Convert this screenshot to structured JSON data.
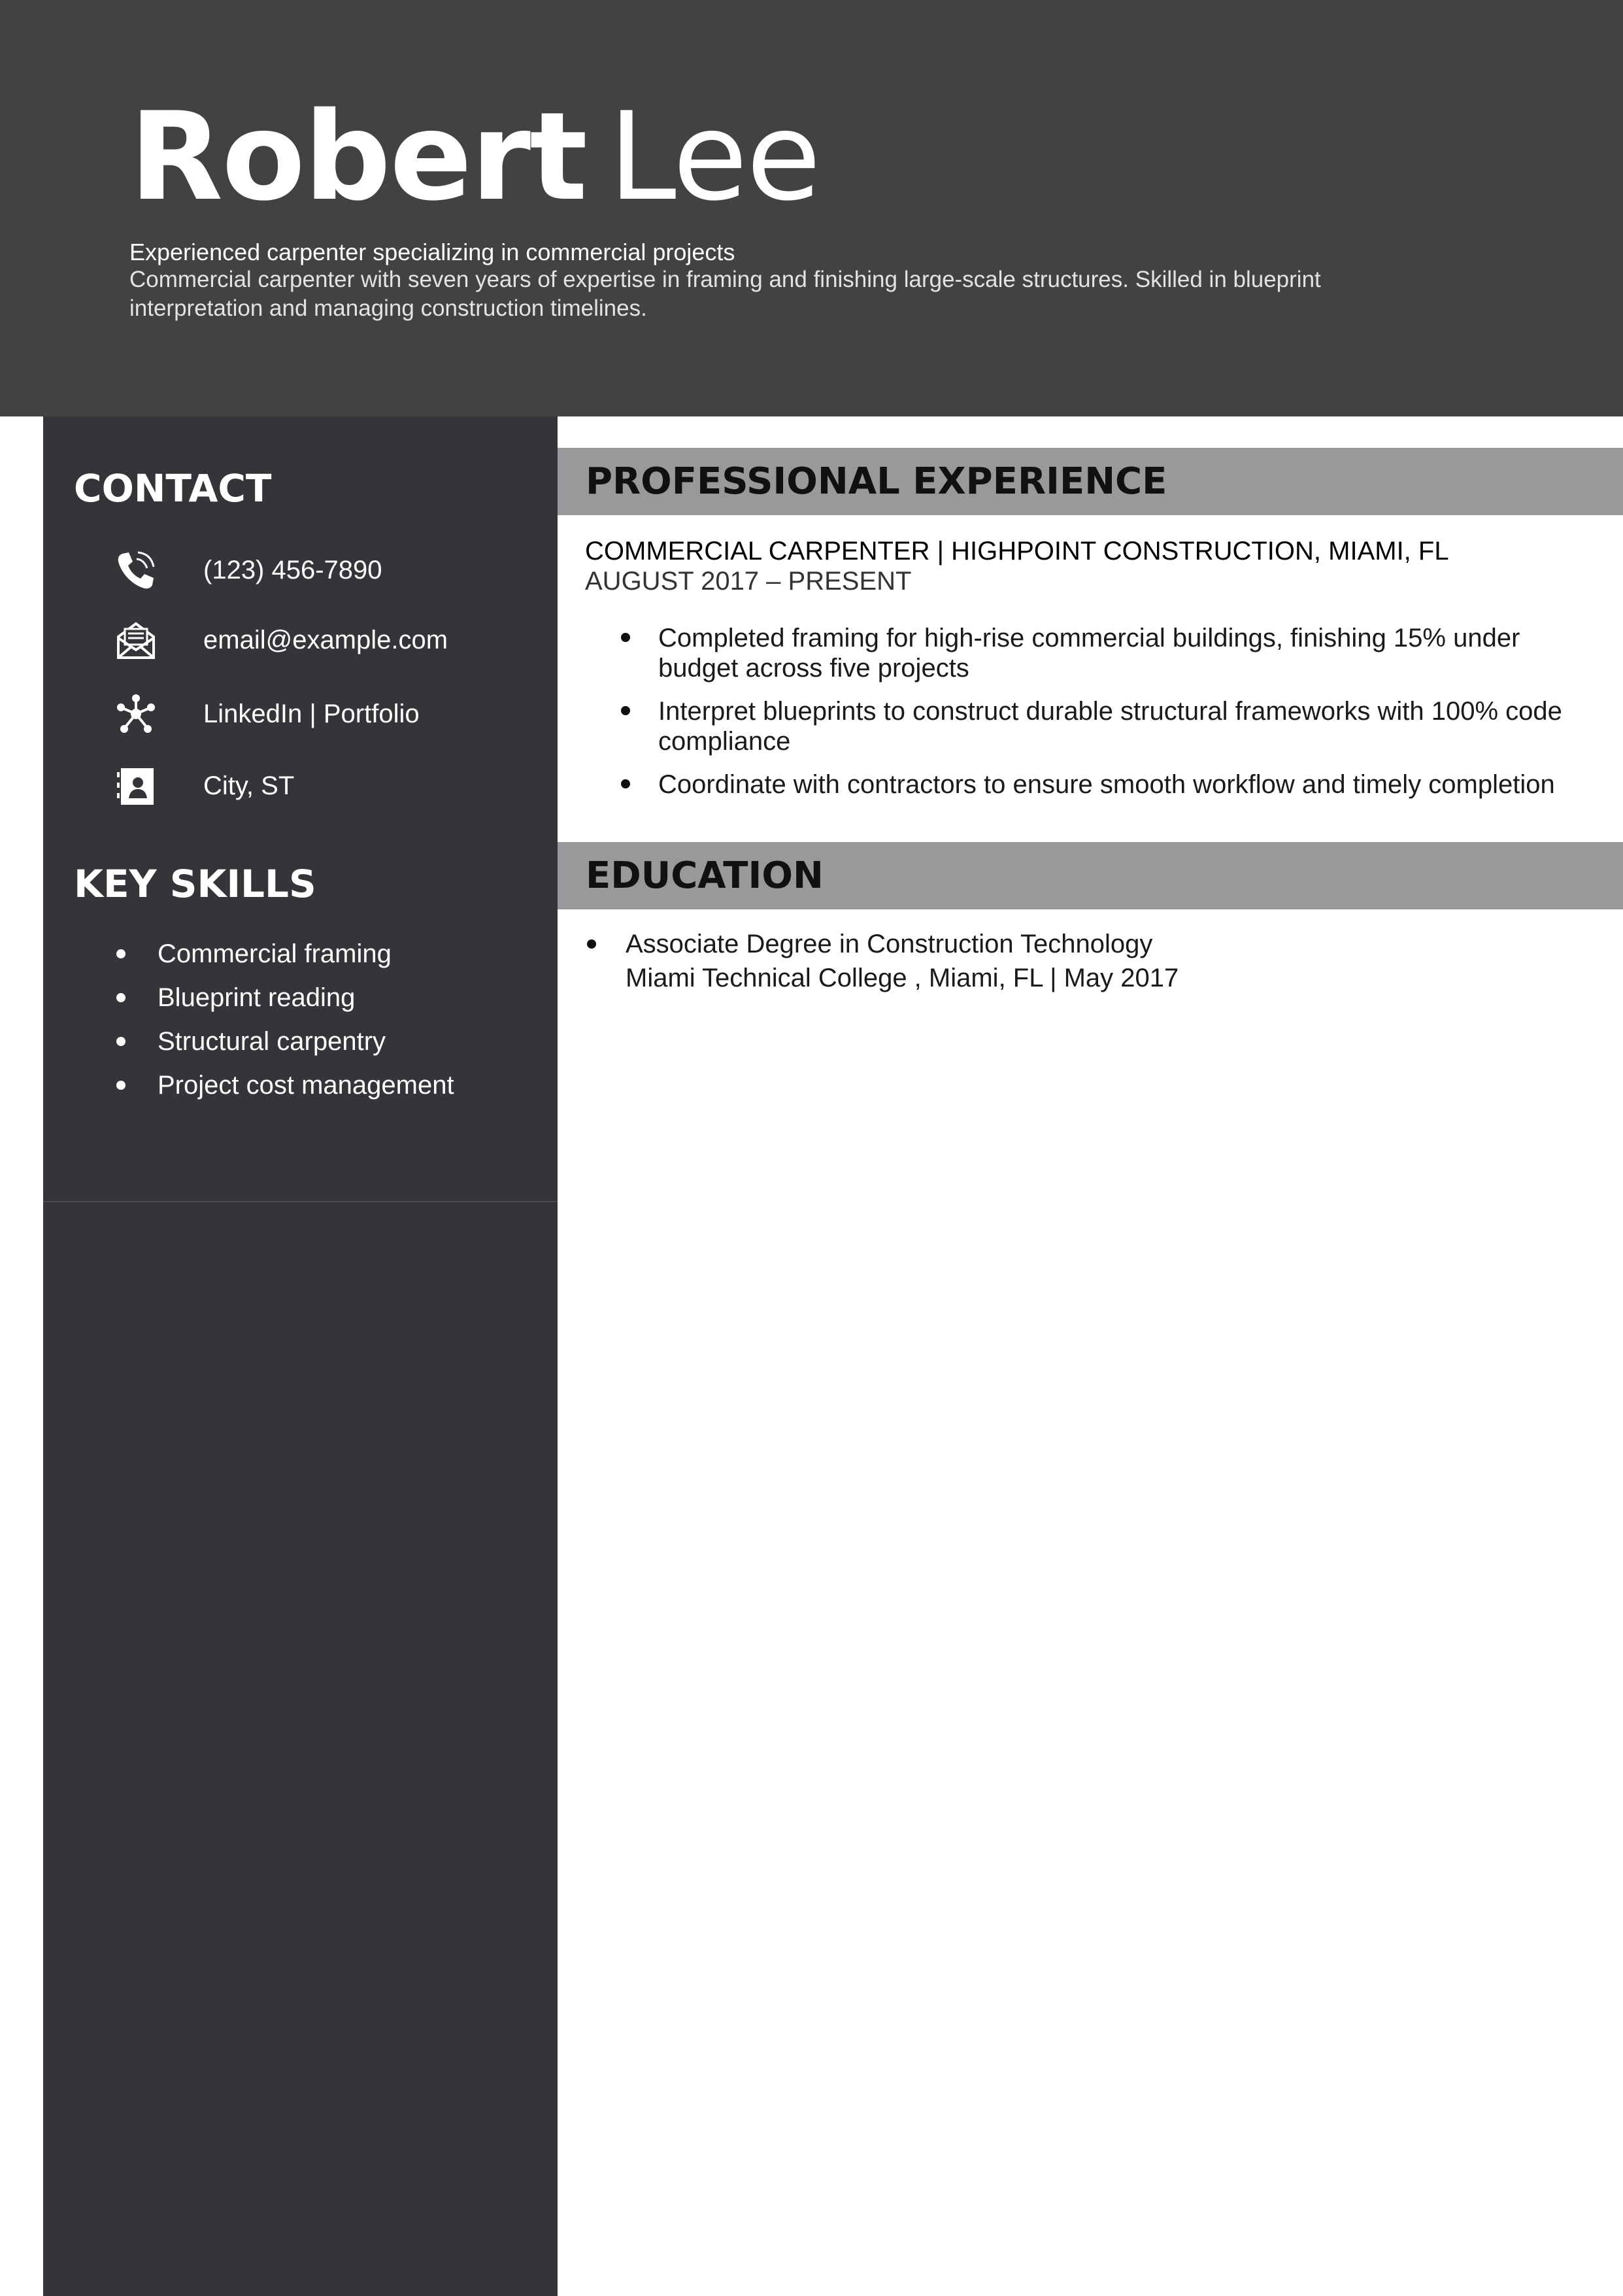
{
  "header": {
    "first_name": "Robert",
    "last_name": "Lee",
    "tagline": "Experienced carpenter specializing in commercial projects",
    "summary": "Commercial carpenter with seven years of expertise in framing and finishing large-scale structures. Skilled in blueprint interpretation and managing construction timelines."
  },
  "contact": {
    "heading": "CONTACT",
    "phone": "(123) 456-7890",
    "email": "email@example.com",
    "links": "LinkedIn | Portfolio",
    "location": "City, ST",
    "icons": [
      "phone-icon",
      "email-icon",
      "network-icon",
      "address-book-icon"
    ]
  },
  "skills": {
    "heading": "KEY SKILLS",
    "items": [
      "Commercial framing",
      "Blueprint reading",
      "Structural carpentry",
      "Project cost management"
    ]
  },
  "experience": {
    "heading": "PROFESSIONAL EXPERIENCE",
    "jobs": [
      {
        "title": "COMMERCIAL CARPENTER | HIGHPOINT CONSTRUCTION, MIAMI, FL",
        "dates": "AUGUST 2017 – PRESENT",
        "bullets": [
          "Completed framing for high-rise commercial buildings, finishing 15% under budget across five projects",
          "Interpret blueprints to construct durable structural frameworks with 100% code compliance",
          "Coordinate with contractors to ensure smooth workflow and timely completion"
        ]
      }
    ]
  },
  "education": {
    "heading": "EDUCATION",
    "items": [
      {
        "degree": "Associate Degree in Construction Technology",
        "details": "Miami Technical College , Miami, FL | May 2017"
      }
    ]
  },
  "colors": {
    "header_bg": "#424242",
    "sidebar_bg": "#343538",
    "section_bar": "#98999b"
  }
}
